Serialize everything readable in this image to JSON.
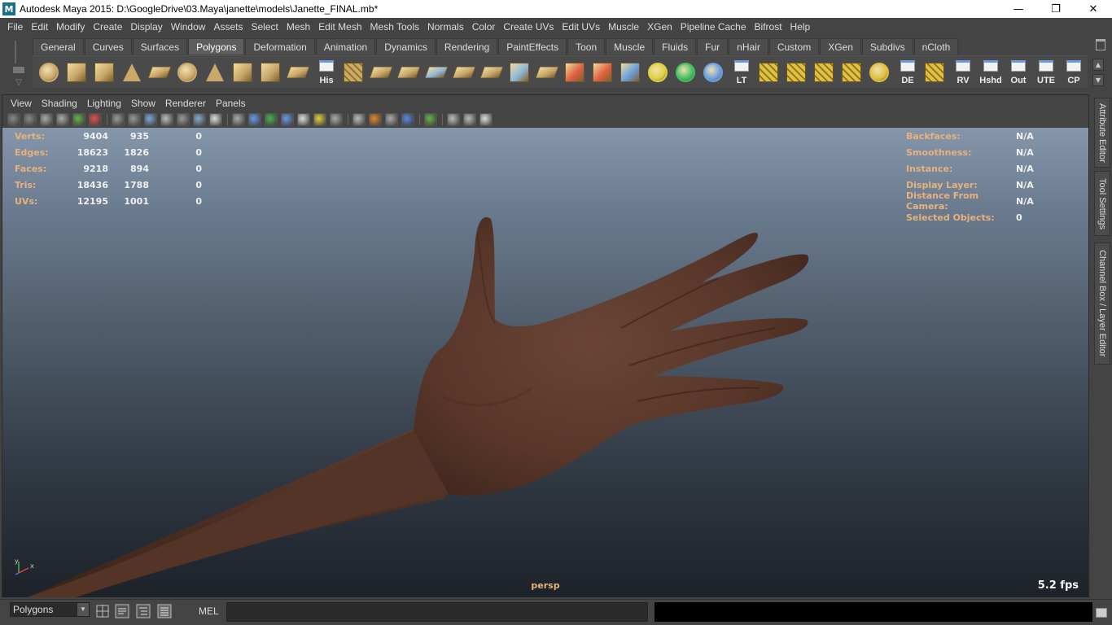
{
  "window": {
    "title": "Autodesk Maya 2015: D:\\GoogleDrive\\03.Maya\\janette\\models\\Janette_FINAL.mb*",
    "app_icon": "M",
    "minimize": "—",
    "restore": "❐",
    "close": "✕"
  },
  "menubar": [
    "File",
    "Edit",
    "Modify",
    "Create",
    "Display",
    "Window",
    "Assets",
    "Select",
    "Mesh",
    "Edit Mesh",
    "Mesh Tools",
    "Normals",
    "Color",
    "Create UVs",
    "Edit UVs",
    "Muscle",
    "XGen",
    "Pipeline Cache",
    "Bifrost",
    "Help"
  ],
  "shelf": {
    "tabs": [
      "General",
      "Curves",
      "Surfaces",
      "Polygons",
      "Deformation",
      "Animation",
      "Dynamics",
      "Rendering",
      "PaintEffects",
      "Toon",
      "Muscle",
      "Fluids",
      "Fur",
      "nHair",
      "Custom",
      "XGen",
      "Subdivs",
      "nCloth"
    ],
    "active_tab": "Polygons",
    "icons": [
      {
        "name": "poly-sphere-icon",
        "label": "",
        "color": "#c9a86a"
      },
      {
        "name": "poly-cube-icon",
        "label": "",
        "color": "#c9a86a"
      },
      {
        "name": "poly-cylinder-icon",
        "label": "",
        "color": "#c9a86a"
      },
      {
        "name": "poly-cone-icon",
        "label": "",
        "color": "#c9a86a"
      },
      {
        "name": "poly-plane-icon",
        "label": "",
        "color": "#c9a86a"
      },
      {
        "name": "poly-torus-icon",
        "label": "",
        "color": "#c9a86a"
      },
      {
        "name": "poly-pyramid-icon",
        "label": "",
        "color": "#c9a86a"
      },
      {
        "name": "poly-pipe-icon",
        "label": "",
        "color": "#c9a86a"
      },
      {
        "name": "create-polygon-tool-icon",
        "label": "",
        "color": "#c9a86a"
      },
      {
        "name": "combine-icon",
        "label": "",
        "color": "#c9a86a"
      },
      {
        "name": "history-icon",
        "label": "His",
        "color": "#eeeeee"
      },
      {
        "name": "extrude-icon",
        "label": "",
        "color": "#c9a86a"
      },
      {
        "name": "bridge-icon",
        "label": "",
        "color": "#c9a86a"
      },
      {
        "name": "append-polygon-icon",
        "label": "",
        "color": "#c9a86a"
      },
      {
        "name": "split-polygon-icon",
        "label": "",
        "color": "#8fb8d8"
      },
      {
        "name": "insert-edge-loop-icon",
        "label": "",
        "color": "#c9a86a"
      },
      {
        "name": "offset-edge-loop-icon",
        "label": "",
        "color": "#c9a86a"
      },
      {
        "name": "sculpt-geometry-icon",
        "label": "",
        "color": "#8fb8d8"
      },
      {
        "name": "planar-mapping-icon",
        "label": "",
        "color": "#c9a86a"
      },
      {
        "name": "soft-mod-icon",
        "label": "",
        "color": "#e06040"
      },
      {
        "name": "paint-tool-icon",
        "label": "",
        "color": "#e06040"
      },
      {
        "name": "lattice-icon",
        "label": "",
        "color": "#6aa0e0"
      },
      {
        "name": "move-tool-icon",
        "label": "",
        "color": "#e0d040"
      },
      {
        "name": "rotate-tool-icon",
        "label": "",
        "color": "#40c060"
      },
      {
        "name": "transform-tool-icon",
        "label": "",
        "color": "#6aa0e0"
      },
      {
        "name": "lt-icon",
        "label": "LT",
        "color": "#eeeeee"
      },
      {
        "name": "uv-layout-icon",
        "label": "",
        "color": "#e0c040"
      },
      {
        "name": "uv-unfold-icon",
        "label": "",
        "color": "#e0c040"
      },
      {
        "name": "uv-sew-icon",
        "label": "",
        "color": "#e0c040"
      },
      {
        "name": "uv-cut-icon",
        "label": "",
        "color": "#e0c040"
      },
      {
        "name": "uv-move-icon",
        "label": "",
        "color": "#e0c040"
      },
      {
        "name": "de-icon",
        "label": "DE",
        "color": "#e0d040"
      },
      {
        "name": "uv-relax-icon",
        "label": "",
        "color": "#e0c040"
      },
      {
        "name": "rv-icon",
        "label": "RV",
        "color": "#eeeeee"
      },
      {
        "name": "hshd-icon",
        "label": "Hshd",
        "color": "#eeeeee"
      },
      {
        "name": "out-icon",
        "label": "Out",
        "color": "#eeeeee"
      },
      {
        "name": "ute-icon",
        "label": "UTE",
        "color": "#eeeeee"
      },
      {
        "name": "cp-icon",
        "label": "CP",
        "color": "#eeeeee"
      }
    ]
  },
  "panel": {
    "menu": [
      "View",
      "Shading",
      "Lighting",
      "Show",
      "Renderer",
      "Panels"
    ],
    "camera": "persp",
    "fps": "5.2 fps",
    "hud_left": [
      {
        "label": "Verts:",
        "v1": "9404",
        "v2": "935",
        "v3": "0"
      },
      {
        "label": "Edges:",
        "v1": "18623",
        "v2": "1826",
        "v3": "0"
      },
      {
        "label": "Faces:",
        "v1": "9218",
        "v2": "894",
        "v3": "0"
      },
      {
        "label": "Tris:",
        "v1": "18436",
        "v2": "1788",
        "v3": "0"
      },
      {
        "label": "UVs:",
        "v1": "12195",
        "v2": "1001",
        "v3": "0"
      }
    ],
    "hud_right": [
      {
        "label": "Backfaces:",
        "value": "N/A"
      },
      {
        "label": "Smoothness:",
        "value": "N/A"
      },
      {
        "label": "Instance:",
        "value": "N/A"
      },
      {
        "label": "Display Layer:",
        "value": "N/A"
      },
      {
        "label": "Distance From Camera:",
        "value": "N/A"
      },
      {
        "label": "Selected Objects:",
        "value": "0"
      }
    ],
    "axis": {
      "x": "x",
      "y": "y"
    }
  },
  "side_tabs": [
    "Attribute Editor",
    "Tool Settings",
    "Channel Box / Layer Editor"
  ],
  "cmdline": {
    "mode": "Polygons",
    "mel_label": "MEL",
    "input_value": ""
  },
  "colors": {
    "hud_label": "#e8b27a",
    "skin": "#5e3b2f",
    "background": "#444444"
  }
}
